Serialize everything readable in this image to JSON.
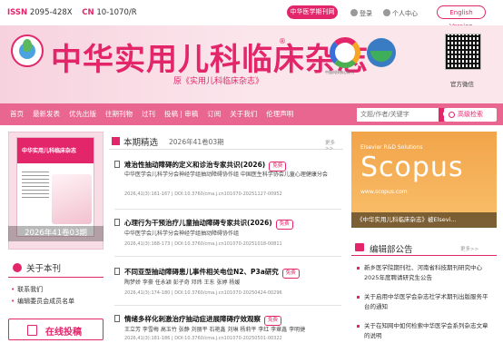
{
  "topbar": {
    "issn_key": "ISSN",
    "issn_val": "2095-428X",
    "cn_key": "CN",
    "cn_val": "10-1070/R",
    "home_btn": "中华医学期刊网",
    "login": "登录",
    "center": "个人中心",
    "english": "English Version"
  },
  "header": {
    "title": "中华实用儿科临床杂志",
    "reg": "®",
    "former_name": "原《实用儿科临床杂志》",
    "badge_caption": "中国科技核心期刊",
    "qr_caption": "官方微信"
  },
  "nav": {
    "items": [
      "首页",
      "最新发表",
      "优先出版",
      "往期刊物",
      "过刊",
      "投稿 | 审稿",
      "订阅",
      "关于我们",
      "伦理声明"
    ],
    "search_placeholder": "文题/作者/关键字",
    "adv_search": "高级检索"
  },
  "left": {
    "cover_title": "中华实用儿科临床杂志",
    "cover_en": "CHINESE JOURNAL OF APPLIED CLINICAL PEDIATRICS",
    "cover_label": "2026年41卷03期",
    "about_title": "关于本刊",
    "about_links": [
      "联系我们",
      "编辑委员会成员名单"
    ],
    "submit": "在线投稿"
  },
  "mid": {
    "title": "本期精选",
    "issue": "2026年41卷03期",
    "more": "更多>>",
    "free": "免费",
    "articles": [
      {
        "title": "难治性抽动障碍的定义和诊治专家共识(2026)",
        "authors": "中华医学会儿科学分会神经学组抽动障碍协作组 中国医生科学协会儿童心理健康分会",
        "cite": "2026,41(3):161-167 | DOI:10.3760/cma.j.cn101070-20251127-00952"
      },
      {
        "title": "心理行为干预治疗儿童抽动障碍专家共识(2026)",
        "authors": "中华医学会儿科学分会神经学组抽动障碍协作组",
        "cite": "2026,41(3):168-173 | DOI:10.3760/cma.j.cn101070-20251018-00811"
      },
      {
        "title": "不同亚型抽动障碍患儿事件相关电位N2、P3a研究",
        "authors": "陶梦娇 李豪 任永颖 彭子奇 邓炜 王东 张婷 杨媛",
        "cite": "2026,41(3):174-180 | DOI:10.3760/cma.j.cn101070-20250424-00296"
      },
      {
        "title": "情绪多样化刺激治疗抽动症进展障碍疗效观察",
        "authors": "王立芳 李雪梅 高玉竹 张静 刘丽平 石艳鑫 刘琳 杨莉平 李红 李章鑫 李明捷",
        "cite": "2026,41(3):181-186 | DOI:10.3760/cma.j.cn101070-20250501-00322"
      }
    ]
  },
  "right": {
    "scopus_top": "Elsevier R&D Solutions",
    "scopus_word": "Scopus",
    "scopus_url": "www.scopus.com",
    "scopus_caption": "《中华实用儿科临床杂志》被Elsevi...",
    "news_title": "编辑部公告",
    "news_more": "更多>>",
    "news": [
      "新乡医学院期刊社、河南省科技期刊研究中心2025年度聘请研究生公告",
      "关于启用中华医学会杂志社学术期刊出版服务平台的通知",
      "关于在知网中如何检索中华医学会系列杂志文章的说明"
    ]
  },
  "colors": {
    "accent": "#e3266a",
    "nav": "#e8668f"
  }
}
